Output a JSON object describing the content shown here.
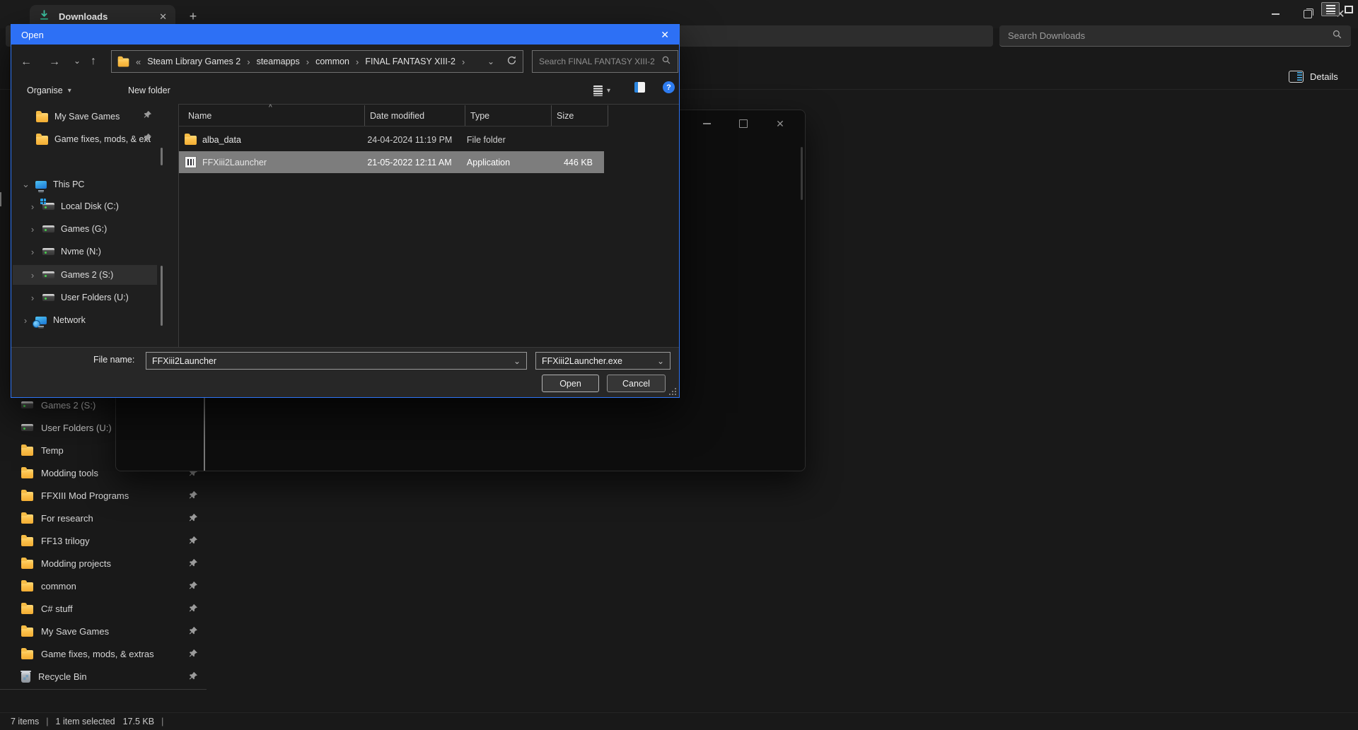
{
  "colors": {
    "accent_blue": "#2d70f5",
    "folder_yellow": "#fcc04a",
    "selection_gray": "#7d7d7d",
    "download_green": "#3ec9a7",
    "background": "#191919"
  },
  "glyphs": {
    "close": "✕",
    "plus": "+",
    "back": "←",
    "forward": "→",
    "up": "↑",
    "chevron_down": "⌄",
    "chevron_right": "›",
    "caret_down": "▾",
    "sort_asc": "^",
    "help": "?",
    "pipe": "|",
    "overflow": "«",
    "crumb_sep": "›"
  },
  "tab_bar": {
    "title": "Downloads"
  },
  "explorer": {
    "search_placeholder": "Search Downloads",
    "details_label": "Details",
    "sidebar": {
      "items": [
        {
          "label": "Games 2 (S:)"
        },
        {
          "label": "User Folders (U:)"
        },
        {
          "label": "Temp"
        },
        {
          "label": "Modding tools"
        },
        {
          "label": "FFXIII Mod Programs"
        },
        {
          "label": "For research"
        },
        {
          "label": "FF13 trilogy"
        },
        {
          "label": "Modding projects"
        },
        {
          "label": "common"
        },
        {
          "label": "C# stuff"
        },
        {
          "label": "My Save Games"
        },
        {
          "label": "Game fixes, mods, & extras"
        },
        {
          "label": "Recycle Bin"
        }
      ]
    },
    "status": {
      "count": "7 items",
      "selected": "1 item selected",
      "size": "17.5 KB"
    }
  },
  "dialog": {
    "title": "Open",
    "crumbs": [
      "Steam Library Games 2",
      "steamapps",
      "common",
      "FINAL FANTASY XIII-2"
    ],
    "search_placeholder": "Search FINAL FANTASY XIII-2",
    "toolbar": {
      "organise": "Organise",
      "new_folder": "New folder"
    },
    "nav_pane": {
      "pinned": [
        {
          "label": "My Save Games"
        },
        {
          "label": "Game fixes, mods, & ext"
        }
      ],
      "tree": [
        {
          "label": "This PC"
        },
        {
          "label": "Local Disk (C:)"
        },
        {
          "label": "Games (G:)"
        },
        {
          "label": "Nvme (N:)"
        },
        {
          "label": "Games 2 (S:)"
        },
        {
          "label": "User Folders (U:)"
        },
        {
          "label": "Network"
        }
      ]
    },
    "list": {
      "columns": [
        "Name",
        "Date modified",
        "Type",
        "Size"
      ],
      "rows": [
        {
          "name": "alba_data",
          "date": "24-04-2024 11:19 PM",
          "type": "File folder",
          "size": ""
        },
        {
          "name": "FFXiii2Launcher",
          "date": "21-05-2022 12:11 AM",
          "type": "Application",
          "size": "446 KB"
        }
      ]
    },
    "footer": {
      "file_name_label": "File name:",
      "file_name_value": "FFXiii2Launcher",
      "file_type_value": "FFXiii2Launcher.exe",
      "open_label": "Open",
      "cancel_label": "Cancel"
    }
  }
}
